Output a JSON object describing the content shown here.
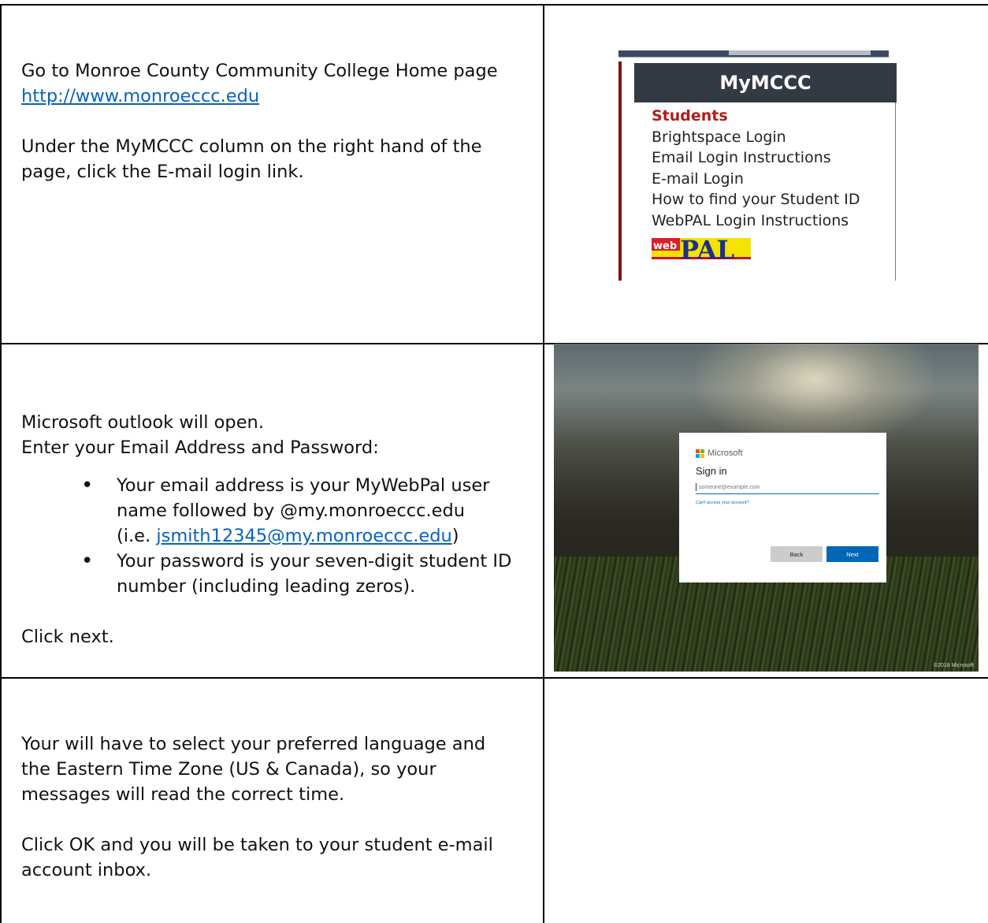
{
  "row1": {
    "line1": "Go to Monroe County Community College Home page",
    "link": "http://www.monroeccc.edu",
    "para2_line1": "Under the MyMCCC column on the right hand of the",
    "para2_line2": "page, click the E-mail login link."
  },
  "mymccc": {
    "header": "MyMCCC",
    "heading": "Students",
    "items": [
      "Brightspace Login",
      "Email Login Instructions",
      "E-mail Login",
      "How to find your Student ID",
      "WebPAL Login Instructions"
    ],
    "webpal_logo_text": "webPAL"
  },
  "row2": {
    "line1": "Microsoft outlook will open.",
    "line2": "Enter your Email Address and Password:",
    "b1_line1": "Your email address is your MyWebPal user",
    "b1_line2": "name followed by @my.monroeccc.edu",
    "b1_line3_pre": "(i.e. ",
    "b1_link": "jsmith12345@my.monroeccc.edu",
    "b1_line3_post": ")",
    "b2_line1": "Your password is your seven-digit student ID",
    "b2_line2": "number (including leading zeros).",
    "click_next": "Click next."
  },
  "signin": {
    "brand": "Microsoft",
    "title": "Sign in",
    "email_placeholder": "someone@example.com",
    "cant_access": "Can't access your account?",
    "back": "Back",
    "next": "Next",
    "copyright": "©2018 Microsoft"
  },
  "row3": {
    "p1_line1": "Your will have to select your preferred language and",
    "p1_line2": "the Eastern Time Zone (US & Canada), so your",
    "p1_line3": "messages will read the correct time.",
    "p2_line1": "Click OK and you will be taken to your student e-mail",
    "p2_line2": "account inbox."
  }
}
